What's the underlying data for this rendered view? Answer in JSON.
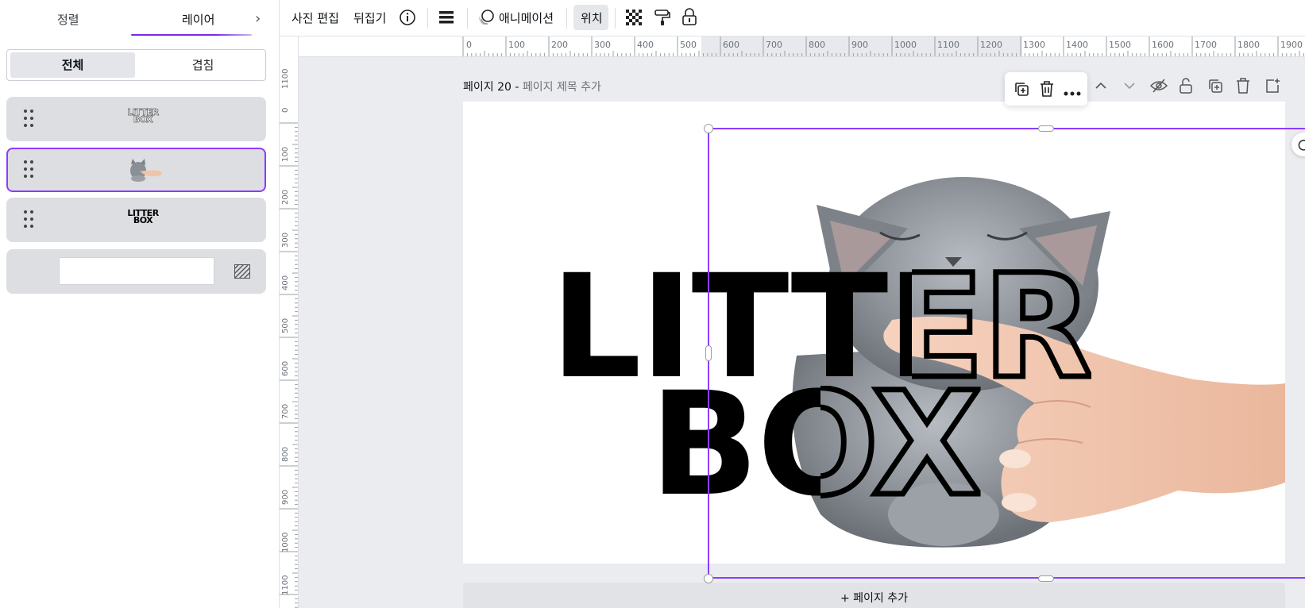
{
  "panel": {
    "tabs": [
      "정렬",
      "레이어"
    ],
    "segments": [
      "전체",
      "겹침"
    ],
    "layers": [
      {
        "type": "outlined-text",
        "thumb_text": "LITTER BOX"
      },
      {
        "type": "image",
        "thumb_text": "cat and hand photo",
        "selected": true
      },
      {
        "type": "solid-text",
        "thumb_text": "LITTER BOX"
      },
      {
        "type": "background",
        "color": "#ffffff"
      }
    ]
  },
  "toolbar": {
    "photo_edit": "사진 편집",
    "flip": "뒤집기",
    "animation": "애니메이션",
    "position": "위치"
  },
  "rulers": {
    "top_labels": [
      "0",
      "100",
      "200",
      "300",
      "400",
      "500",
      "600",
      "700",
      "800",
      "900",
      "1000",
      "1100",
      "1200",
      "1300",
      "1400",
      "1500",
      "1600",
      "1700",
      "1800",
      "1900"
    ],
    "left_labels": [
      "1100",
      "0",
      "100",
      "200",
      "300",
      "400",
      "500",
      "600",
      "700",
      "800",
      "900",
      "1000",
      "1100"
    ]
  },
  "canvas": {
    "page_label": "페이지 20 -",
    "page_title_placeholder": "페이지 제목 추가",
    "add_page": "+ 페이지 추가",
    "design_text_line1": "LITTER",
    "design_text_line2": "BOX"
  },
  "colors": {
    "accent": "#8b3dff",
    "selection": "#8b3dff"
  }
}
